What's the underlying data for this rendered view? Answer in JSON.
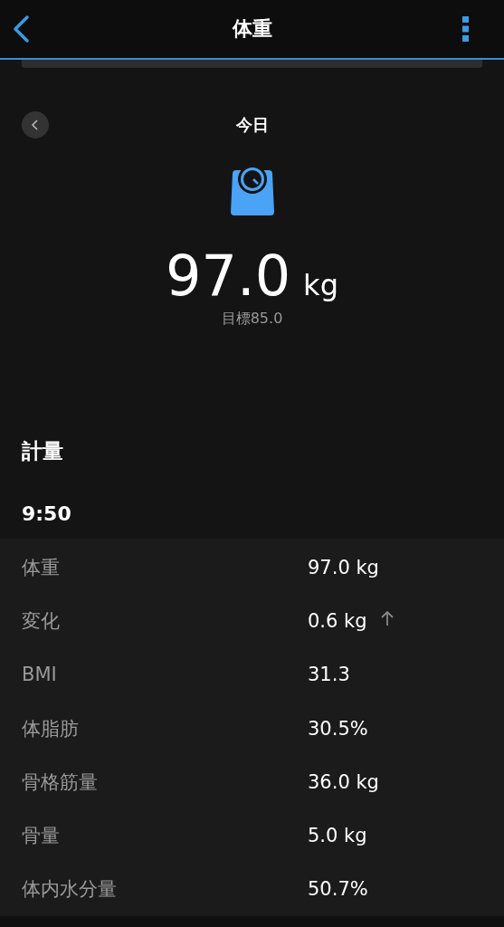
{
  "header": {
    "title": "体重"
  },
  "summary": {
    "period": "今日",
    "value": "97.0",
    "unit": "kg",
    "goal": "目標85.0"
  },
  "section": {
    "title": "計量",
    "time": "9:50"
  },
  "rows": [
    {
      "label": "体重",
      "value": "97.0 kg"
    },
    {
      "label": "変化",
      "value": "0.6 kg",
      "increase": true
    },
    {
      "label": "BMI",
      "value": "31.3"
    },
    {
      "label": "体脂肪",
      "value": "30.5%"
    },
    {
      "label": "骨格筋量",
      "value": "36.0 kg"
    },
    {
      "label": "骨量",
      "value": "5.0 kg"
    },
    {
      "label": "体内水分量",
      "value": "50.7%"
    }
  ]
}
